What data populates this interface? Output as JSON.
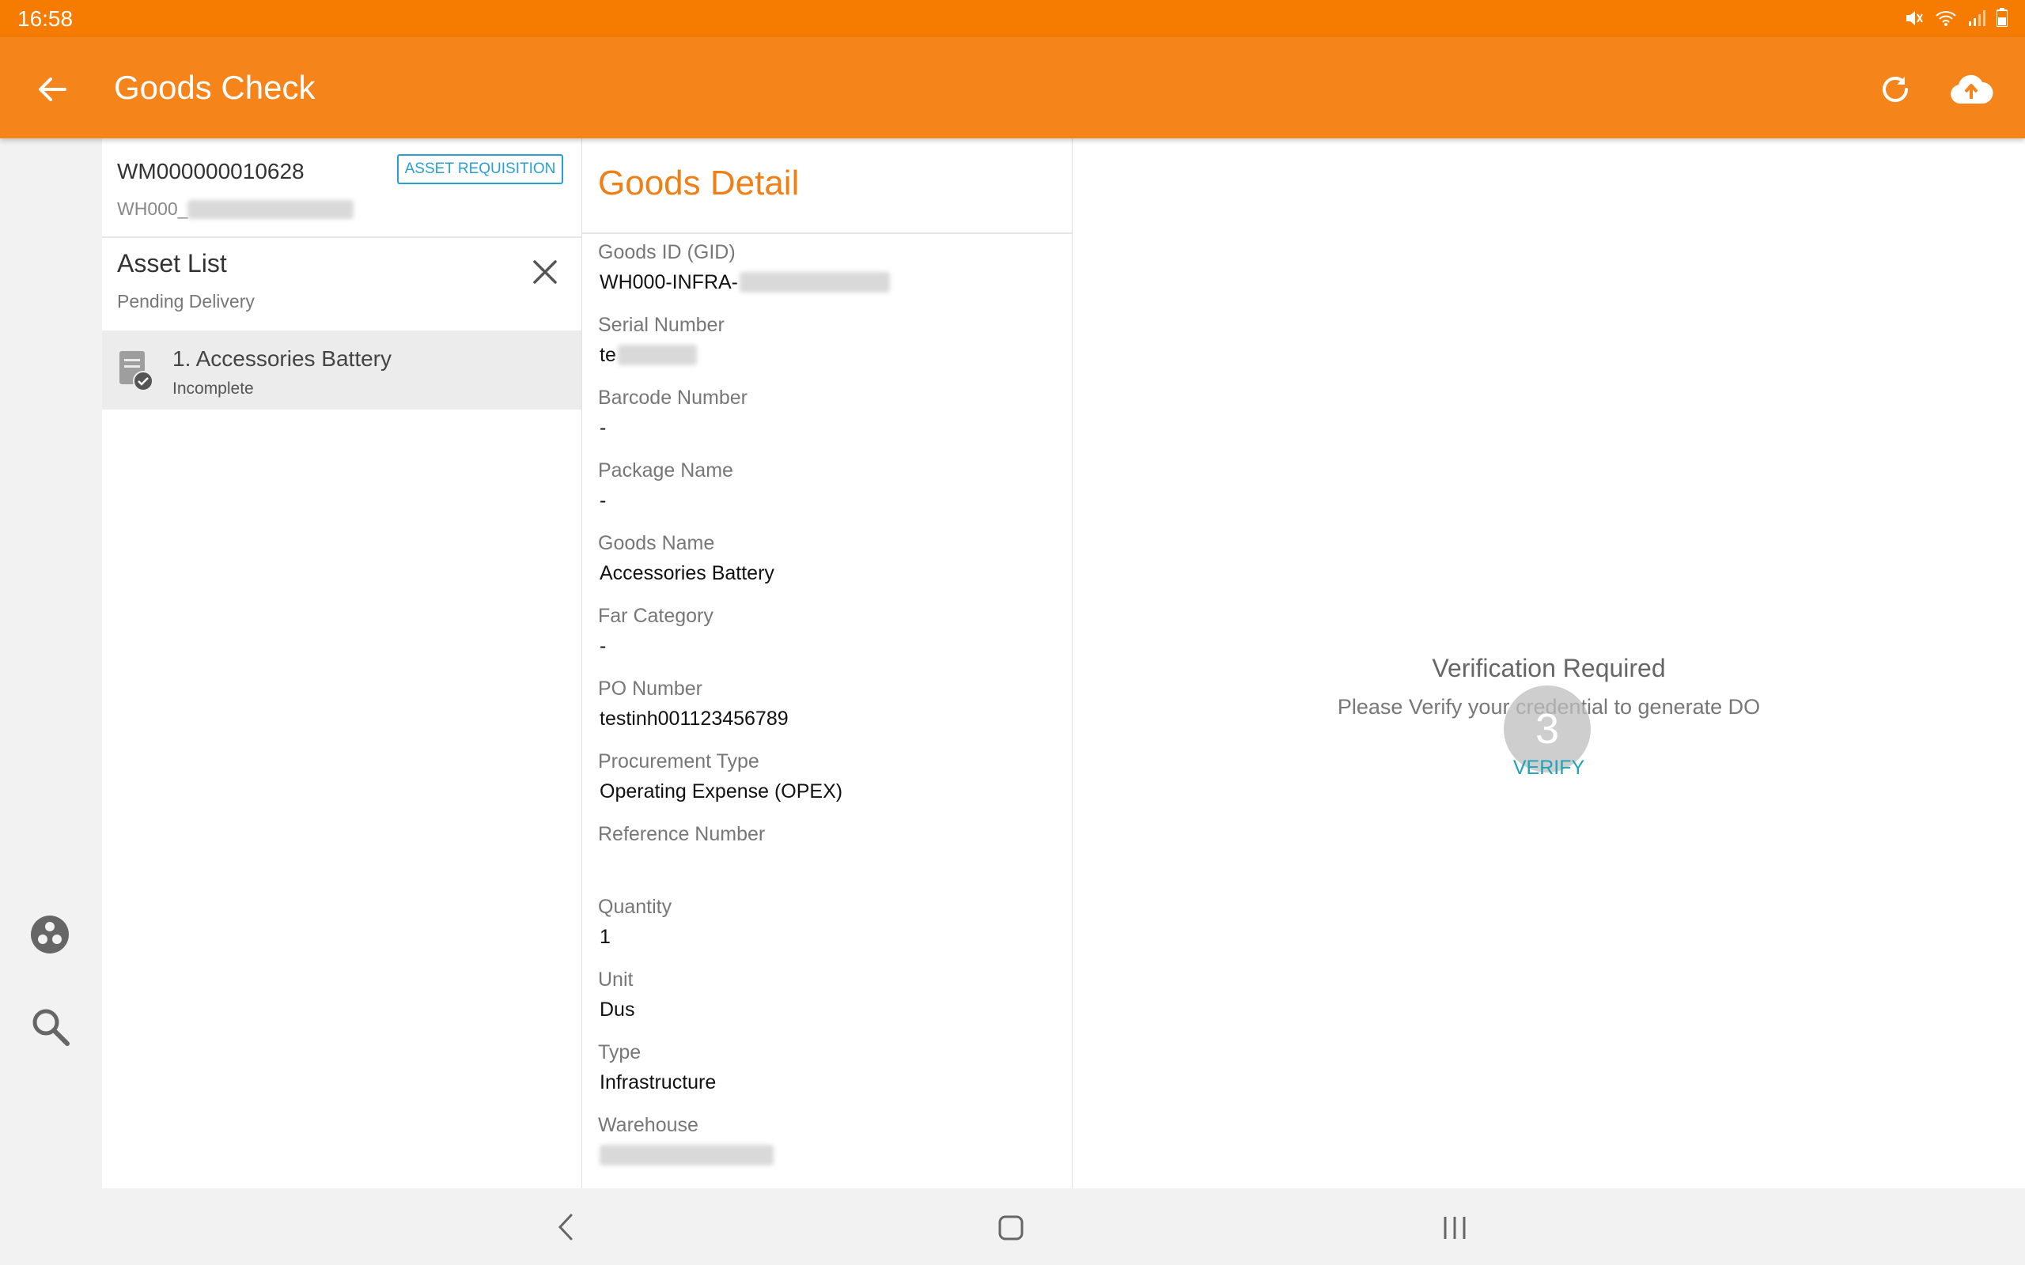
{
  "status_bar": {
    "time": "16:58"
  },
  "app_bar": {
    "title": "Goods Check"
  },
  "request": {
    "id": "WM000000010628",
    "warehouse_prefix": "WH000_",
    "type_badge": "ASSET REQUISITION"
  },
  "asset_list": {
    "title": "Asset List",
    "subtitle": "Pending Delivery",
    "items": [
      {
        "name": "1. Accessories Battery",
        "status": "Incomplete"
      }
    ]
  },
  "goods_detail": {
    "title": "Goods Detail",
    "fields": [
      {
        "label": "Goods ID (GID)",
        "value": "WH000-INFRA-"
      },
      {
        "label": "Serial Number",
        "value": "te"
      },
      {
        "label": "Barcode Number",
        "value": "-"
      },
      {
        "label": "Package Name",
        "value": "-"
      },
      {
        "label": "Goods Name",
        "value": "Accessories Battery"
      },
      {
        "label": "Far Category",
        "value": "-"
      },
      {
        "label": "PO Number",
        "value": "testinh001123456789"
      },
      {
        "label": "Procurement Type",
        "value": "Operating Expense (OPEX)"
      },
      {
        "label": "Reference Number",
        "value": ""
      },
      {
        "label": "Quantity",
        "value": "1"
      },
      {
        "label": "Unit",
        "value": "Dus"
      },
      {
        "label": "Type",
        "value": "Infrastructure"
      },
      {
        "label": "Warehouse",
        "value": ""
      }
    ]
  },
  "verification": {
    "title": "Verification Required",
    "message": "Please Verify your credential to generate DO",
    "button_label": "VERIFY",
    "touch_indicator": "3"
  },
  "colors": {
    "status_bar": "#f57c00",
    "app_bar": "#f5841b",
    "accent_title": "#f07f16",
    "badge": "#2a9fd6",
    "verify_button": "#1fa3b8"
  },
  "icons": {
    "back": "arrow-left-icon",
    "refresh": "refresh-icon",
    "upload": "cloud-upload-icon",
    "close": "close-icon",
    "document": "document-check-icon",
    "rail_top": "group-icon",
    "rail_search": "search-icon"
  }
}
